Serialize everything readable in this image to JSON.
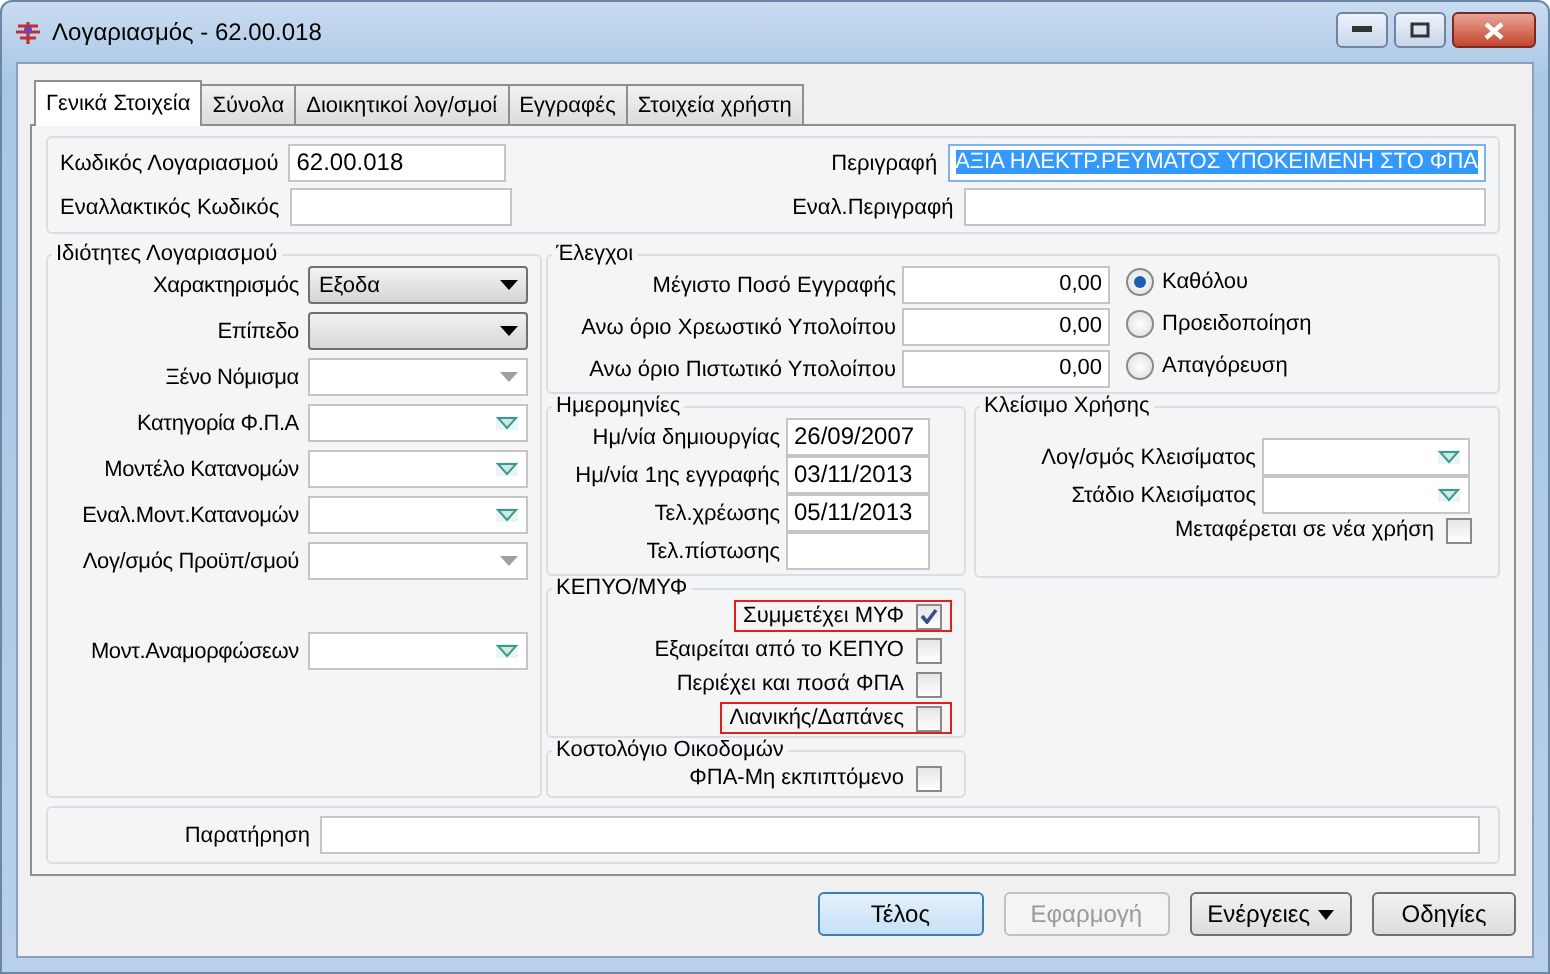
{
  "window": {
    "title": "Λογαριασμός - 62.00.018"
  },
  "tabs": [
    {
      "label": "Γενικά Στοιχεία",
      "selected": true
    },
    {
      "label": "Σύνολα",
      "selected": false
    },
    {
      "label": "Διοικητικοί λογ/σμοί",
      "selected": false
    },
    {
      "label": "Εγγραφές",
      "selected": false
    },
    {
      "label": "Στοιχεία χρήστη",
      "selected": false
    }
  ],
  "header": {
    "fields": [
      {
        "label": "Κωδικός Λογαριασμού",
        "value": "62.00.018",
        "highlighted": false
      },
      {
        "label": "Περιγραφή",
        "value": "ΑΞΙΑ ΗΛΕΚΤΡ.ΡΕΥΜΑΤΟΣ ΥΠΟΚΕΙΜΕΝΗ ΣΤΟ ΦΠΑ",
        "highlighted": true
      },
      {
        "label": "Εναλλακτικός Κωδικός"
      },
      {
        "label": "Εναλ.Περιγραφή"
      }
    ]
  },
  "properties": {
    "title": "Ιδιότητες Λογαριασμού",
    "fields": [
      {
        "label": "Χαρακτηρισμός",
        "value": "Εξοδα",
        "kind": "combo",
        "disabled": false
      },
      {
        "label": "Επίπεδο",
        "kind": "combo",
        "disabled": false
      },
      {
        "label": "Ξένο Νόμισμα",
        "kind": "combo",
        "disabled": true
      },
      {
        "label": "Κατηγορία Φ.Π.Α",
        "kind": "lookup",
        "disabled": false
      },
      {
        "label": "Μοντέλο Κατανομών",
        "kind": "lookup",
        "disabled": false
      },
      {
        "label": "Εναλ.Μοντ.Κατανομών",
        "kind": "lookup",
        "disabled": false
      },
      {
        "label": "Λογ/σμός Προϋπ/σμού",
        "kind": "combo",
        "disabled": true
      },
      {
        "label": "Μοντ.Αναμορφώσεων",
        "kind": "lookup",
        "disabled": false
      }
    ]
  },
  "checks": {
    "title": "Έλεγχοι",
    "fields": [
      {
        "label": "Μέγιστο Ποσό Εγγραφής",
        "value": "0,00"
      },
      {
        "label": "Ανω όριο Χρεωστικό Υπολοίπου",
        "value": "0,00"
      },
      {
        "label": "Ανω όριο Πιστωτικό Υπολοίπου",
        "value": "0,00"
      }
    ],
    "options": [
      {
        "label": "Καθόλου",
        "selected": true
      },
      {
        "label": "Προειδοποίηση",
        "selected": false
      },
      {
        "label": "Απαγόρευση",
        "selected": false
      }
    ]
  },
  "dates": {
    "title": "Ημερομηνίες",
    "fields": [
      {
        "label": "Ημ/νία δημιουργίας",
        "value": "26/09/2007"
      },
      {
        "label": "Ημ/νία 1ης εγγραφής",
        "value": "03/11/2013"
      },
      {
        "label": "Τελ.χρέωσης",
        "value": "05/11/2013"
      },
      {
        "label": "Τελ.πίστωσης"
      }
    ]
  },
  "closing": {
    "title": "Κλείσιμο Χρήσης",
    "fields": [
      {
        "label": "Λογ/σμός Κλεισίματος"
      },
      {
        "label": "Στάδιο Κλεισίματος"
      }
    ],
    "checkbox": {
      "label": "Μεταφέρεται σε νέα χρήση",
      "checked": false
    }
  },
  "kepyo": {
    "title": "ΚΕΠΥΟ/ΜΥΦ",
    "items": [
      {
        "label": "Συμμετέχει ΜΥΦ",
        "checked": true,
        "flagged": true
      },
      {
        "label": "Εξαιρείται από το ΚΕΠΥΟ",
        "checked": false,
        "flagged": false
      },
      {
        "label": "Περιέχει και ποσά ΦΠΑ",
        "checked": false,
        "flagged": false
      },
      {
        "label": "Λιανικής/Δαπάνες",
        "checked": false,
        "flagged": true
      }
    ]
  },
  "costing": {
    "title": "Κοστολόγιο Οικοδομών",
    "items": [
      {
        "label": "ΦΠΑ-Μη εκπιπτόμενο",
        "checked": false,
        "flagged": false
      }
    ]
  },
  "note": {
    "label": "Παρατήρηση"
  },
  "buttons": [
    {
      "label": "Τέλος",
      "kind": "default",
      "disabled": false
    },
    {
      "label": "Εφαρμογή",
      "kind": "plain",
      "disabled": true
    },
    {
      "label": "Ενέργειες",
      "kind": "menu",
      "disabled": false
    },
    {
      "label": "Οδηγίες",
      "kind": "plain",
      "disabled": false
    }
  ]
}
